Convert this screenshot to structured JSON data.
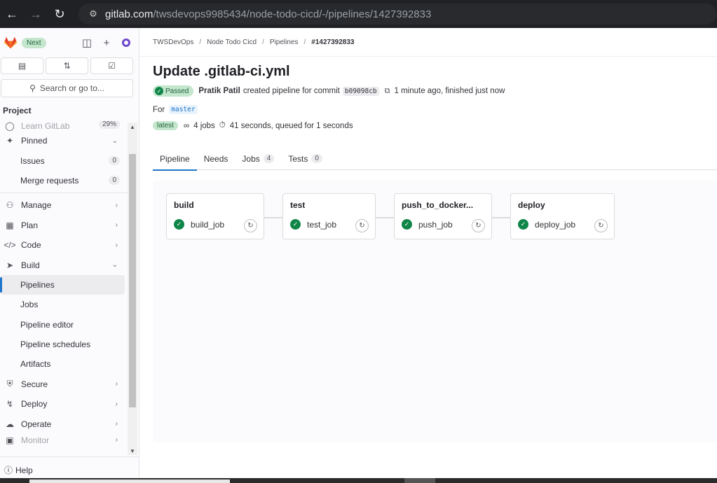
{
  "browser": {
    "url_host": "gitlab.com",
    "url_path": "/twsdevops9985434/node-todo-cicd/-/pipelines/1427392833"
  },
  "sidebar": {
    "next_badge": "Next",
    "search_label": "Search or go to...",
    "section": "Project",
    "learn": {
      "label": "Learn GitLab",
      "count": "29%"
    },
    "pinned": "Pinned",
    "pinned_items": [
      {
        "label": "Issues",
        "count": "0"
      },
      {
        "label": "Merge requests",
        "count": "0"
      }
    ],
    "manage": "Manage",
    "plan": "Plan",
    "code": "Code",
    "build": "Build",
    "build_items": [
      "Pipelines",
      "Jobs",
      "Pipeline editor",
      "Pipeline schedules",
      "Artifacts"
    ],
    "secure": "Secure",
    "deploy": "Deploy",
    "operate": "Operate",
    "monitor": "Monitor",
    "help": "Help"
  },
  "breadcrumb": {
    "items": [
      "TWSDevOps",
      "Node Todo Cicd",
      "Pipelines"
    ],
    "current": "#1427392833"
  },
  "pipeline": {
    "title": "Update .gitlab-ci.yml",
    "status": "Passed",
    "author": "Pratik Patil",
    "created_text": "created pipeline for commit",
    "sha": "b09098cb",
    "time_text": "1 minute ago, finished just now",
    "for_label": "For",
    "branch": "master",
    "latest": "latest",
    "jobs_count": "4 jobs",
    "duration": "41 seconds, queued for 1 seconds"
  },
  "tabs": [
    {
      "label": "Pipeline",
      "count": ""
    },
    {
      "label": "Needs",
      "count": ""
    },
    {
      "label": "Jobs",
      "count": "4"
    },
    {
      "label": "Tests",
      "count": "0"
    }
  ],
  "stages": [
    {
      "name": "build",
      "job": "build_job"
    },
    {
      "name": "test",
      "job": "test_job"
    },
    {
      "name": "push_to_docker...",
      "job": "push_job"
    },
    {
      "name": "deploy",
      "job": "deploy_job"
    }
  ],
  "colors": {
    "accent": "#1f75cb",
    "success": "#108548",
    "success_bg": "#c3e6cd"
  }
}
